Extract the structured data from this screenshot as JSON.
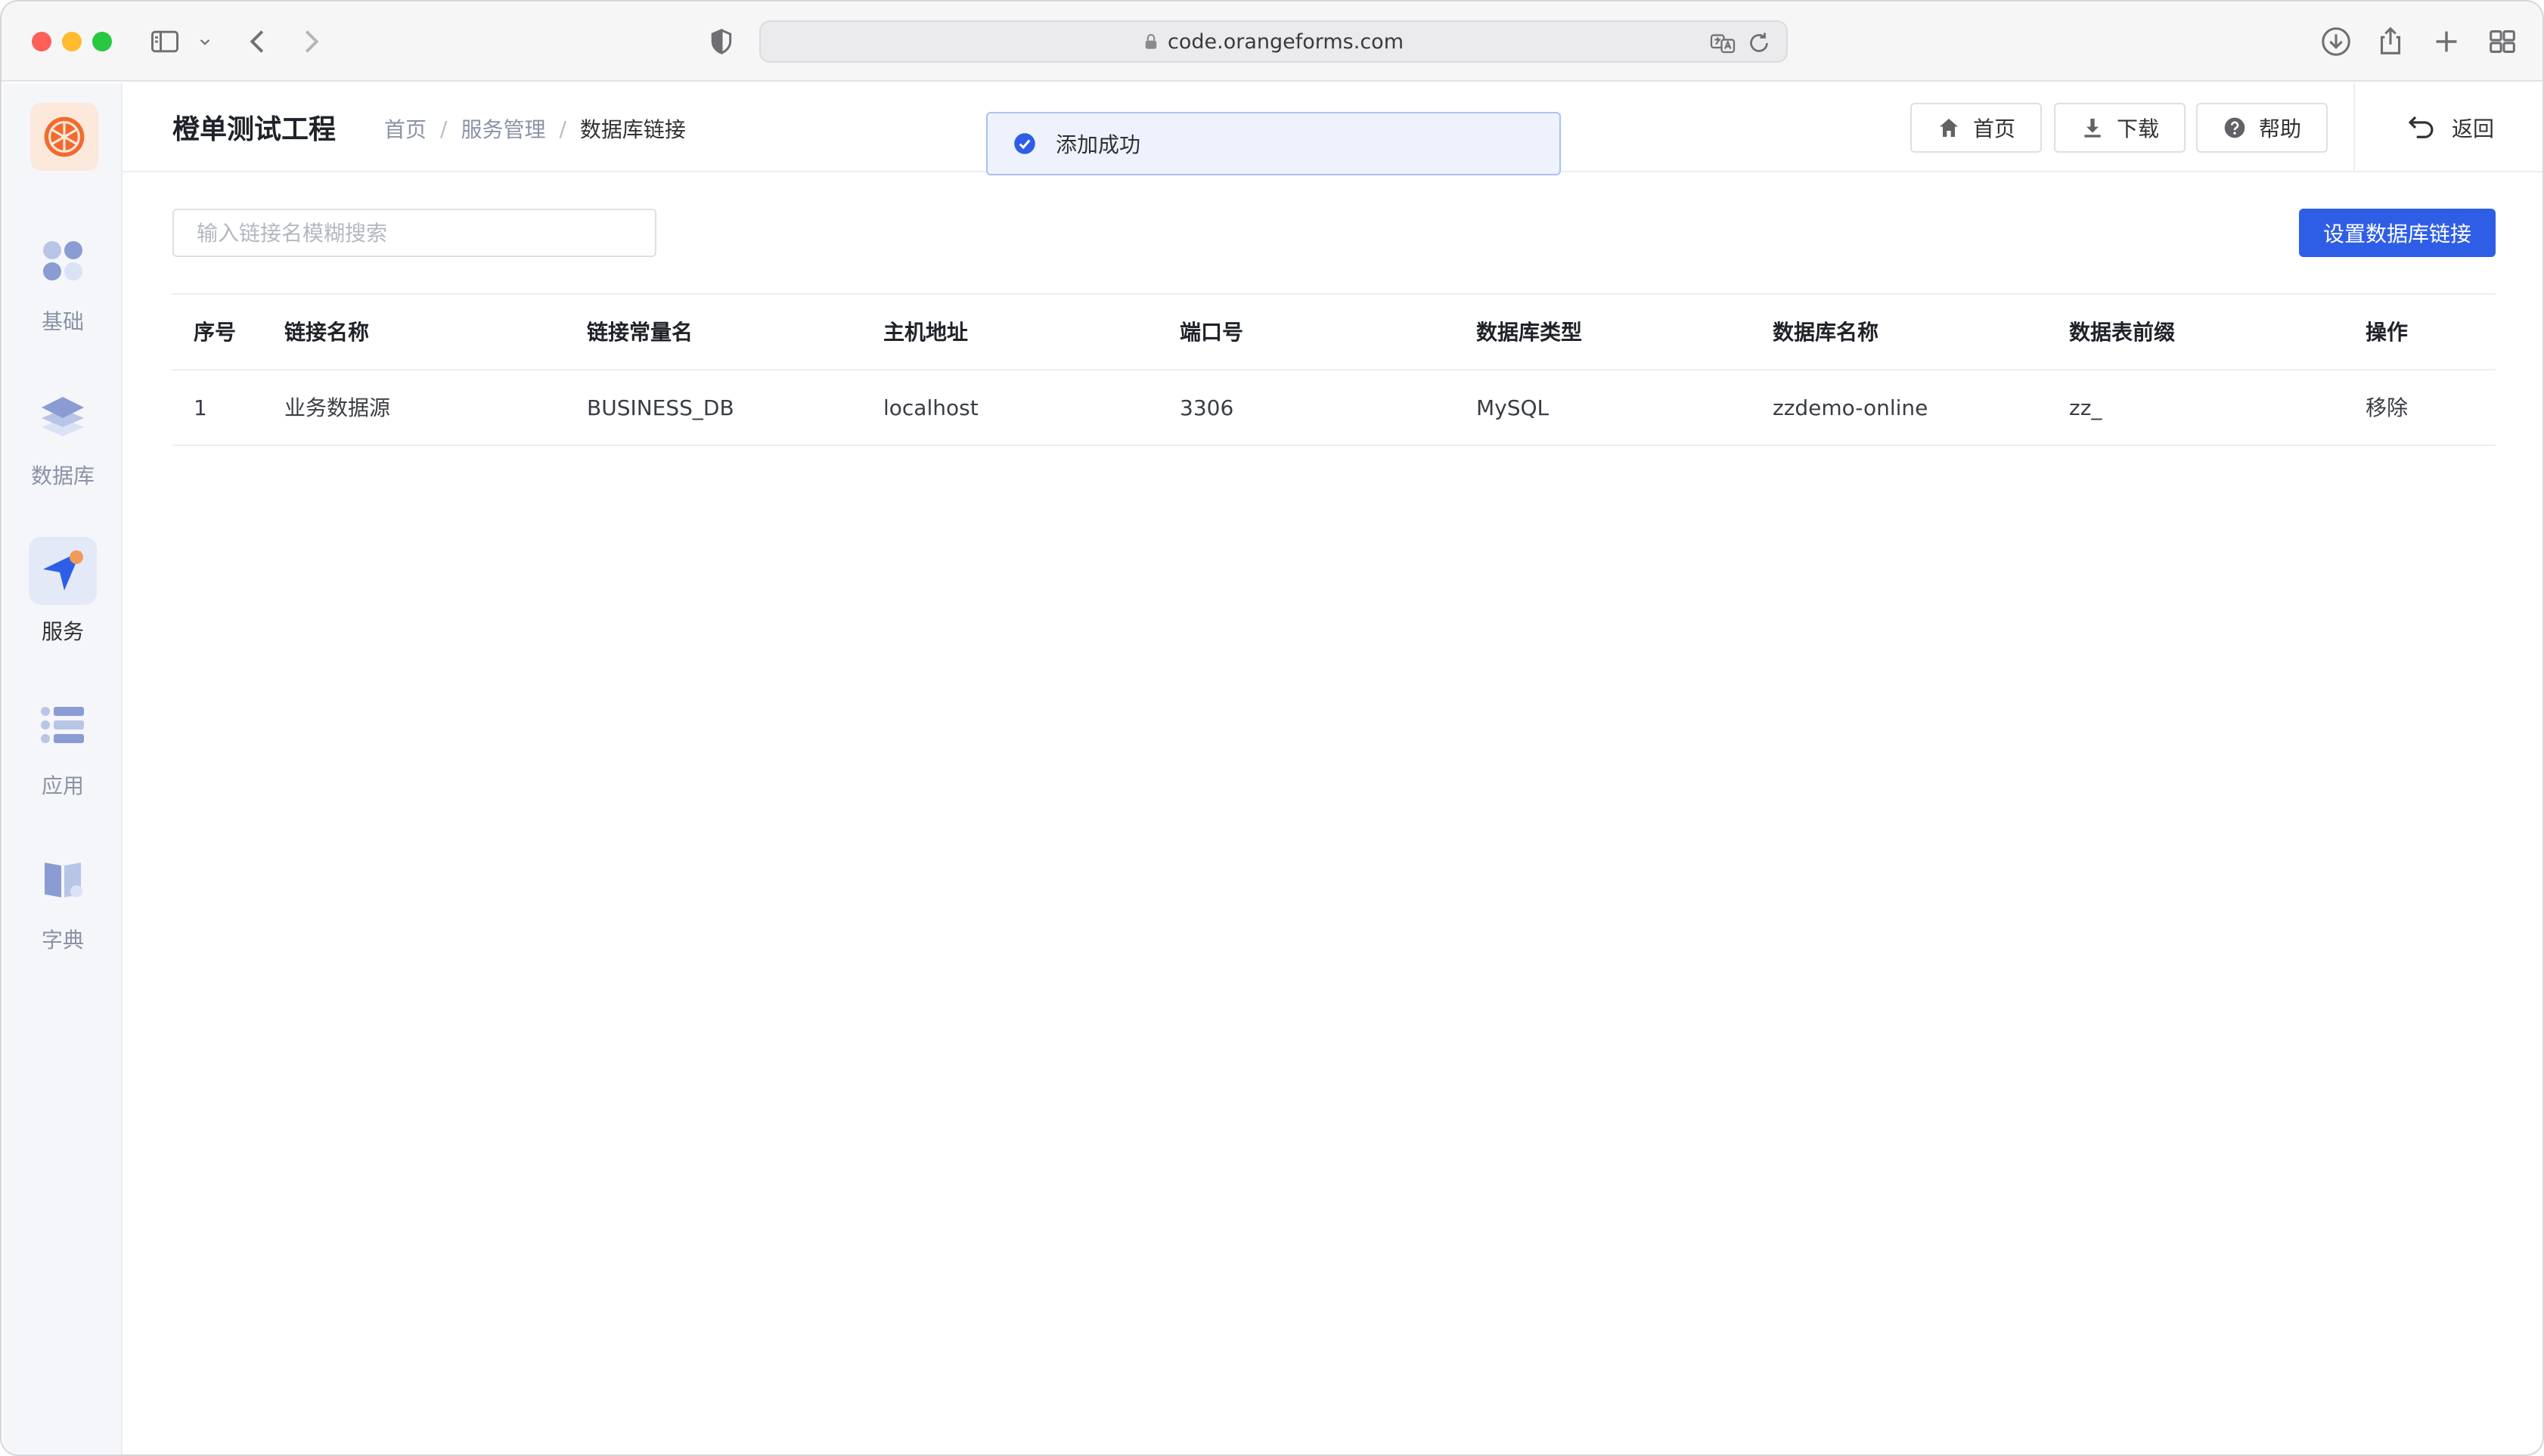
{
  "browser": {
    "url": "code.orangeforms.com"
  },
  "sidebar": {
    "items": [
      {
        "label": "基础",
        "icon": "blocks-icon",
        "active": false
      },
      {
        "label": "数据库",
        "icon": "database-layers-icon",
        "active": false
      },
      {
        "label": "服务",
        "icon": "navigation-arrow-icon",
        "active": true
      },
      {
        "label": "应用",
        "icon": "list-icon",
        "active": false
      },
      {
        "label": "字典",
        "icon": "book-icon",
        "active": false
      }
    ]
  },
  "header": {
    "title": "橙单测试工程",
    "breadcrumb": [
      "首页",
      "服务管理",
      "数据库链接"
    ],
    "breadcrumb_sep": "/",
    "buttons": {
      "home": "首页",
      "download": "下载",
      "help": "帮助",
      "back": "返回"
    }
  },
  "toast": {
    "message": "添加成功",
    "color": "#2f5ee6"
  },
  "toolbar": {
    "search_placeholder": "输入链接名模糊搜索",
    "search_value": "",
    "primary_label": "设置数据库链接"
  },
  "table": {
    "columns": [
      "序号",
      "链接名称",
      "链接常量名",
      "主机地址",
      "端口号",
      "数据库类型",
      "数据库名称",
      "数据表前缀",
      "操作"
    ],
    "rows": [
      [
        "1",
        "业务数据源",
        "BUSINESS_DB",
        "localhost",
        "3306",
        "MySQL",
        "zzdemo-online",
        "zz_",
        "移除"
      ]
    ]
  },
  "colors": {
    "accent": "#2f5ee6",
    "logo_orange": "#f26b2e"
  }
}
